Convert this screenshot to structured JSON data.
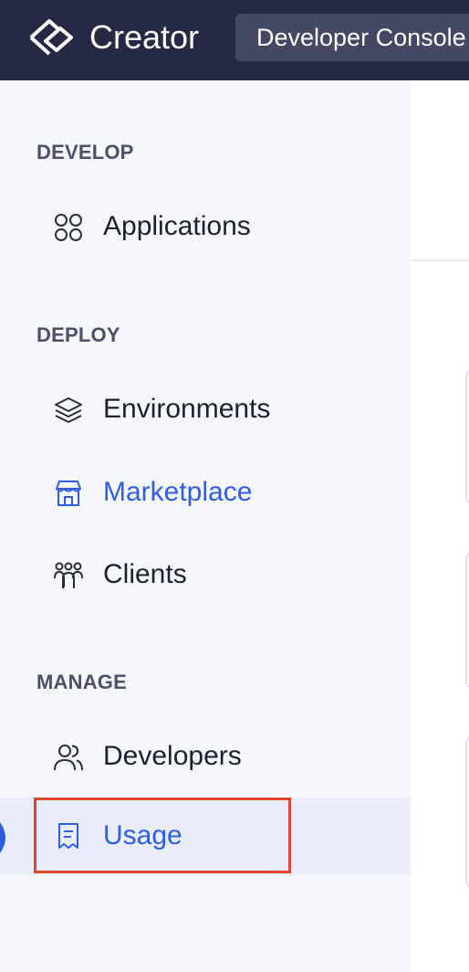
{
  "header": {
    "app_name": "Creator",
    "console_label": "Developer Console",
    "logo_icon": "creator-logo-icon"
  },
  "sidebar": {
    "sections": [
      {
        "title": "DEVELOP"
      },
      {
        "title": "DEPLOY"
      },
      {
        "title": "MANAGE"
      }
    ],
    "items": [
      {
        "label": "Applications",
        "icon": "apps-grid-icon"
      },
      {
        "label": "Environments",
        "icon": "layers-icon"
      },
      {
        "label": "Marketplace",
        "icon": "storefront-icon"
      },
      {
        "label": "Clients",
        "icon": "clients-group-icon"
      },
      {
        "label": "Developers",
        "icon": "users-icon"
      },
      {
        "label": "Usage",
        "icon": "receipt-icon"
      }
    ],
    "selected": "Usage"
  },
  "colors": {
    "topbar": "#262944",
    "sidebar_bg": "#f6f7fb",
    "accent": "#2f5ee0",
    "selected_bg": "#e8ecfb",
    "highlight": "#e04432"
  }
}
